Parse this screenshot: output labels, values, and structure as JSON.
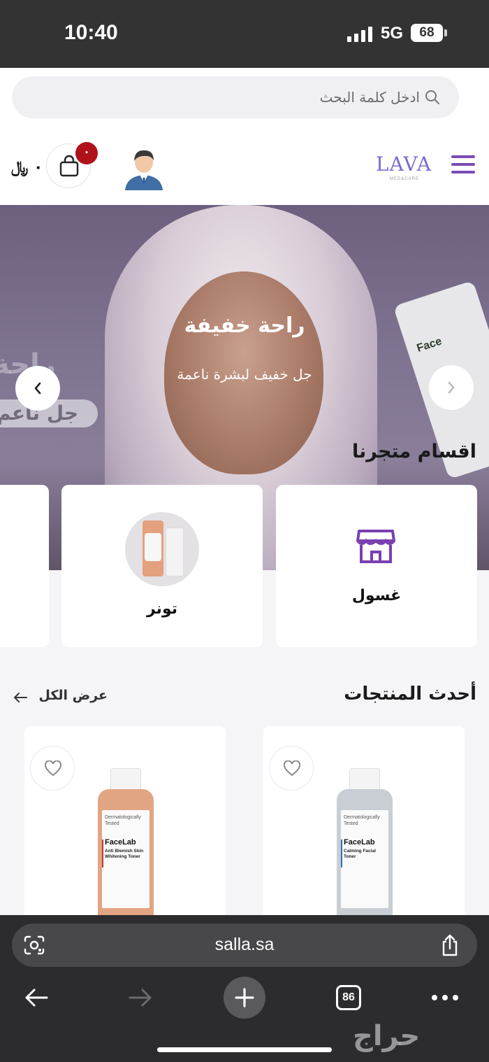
{
  "status_bar": {
    "time": "10:40",
    "network": "5G",
    "battery": "68"
  },
  "search": {
    "placeholder": "ادخل كلمة البحث"
  },
  "header": {
    "currency": "٠ ﷼",
    "cart_count": "٠",
    "logo_text": "LAVA",
    "logo_subtext": "MED&CARE"
  },
  "hero": {
    "title": "راحة خفيفة",
    "subtitle": "جل خفيف لبشرة ناعمة",
    "side_text": "راحة",
    "side_pill": "جل ناعم",
    "bottle_label": "Face"
  },
  "categories": {
    "title": "اقسام متجرنا",
    "items": [
      {
        "label": "غسول",
        "icon": "store-icon"
      },
      {
        "label": "تونر",
        "icon": "toner-image"
      }
    ]
  },
  "latest": {
    "title": "أحدث المنتجات",
    "view_all": "عرض الكل",
    "products": [
      {
        "brand": "FaceLab",
        "tested": "Dermatologically Tested",
        "name": "Calming Facial Toner",
        "body_color": "#c9ced4",
        "stripe_color": "#2f6fbf"
      },
      {
        "brand": "FaceLab",
        "tested": "Dermatologically Tested",
        "name": "Anti Blemish Skin Whitening Toner",
        "body_color": "#e2a583",
        "stripe_color": "#c0392b"
      }
    ]
  },
  "browser": {
    "url": "salla.sa",
    "tab_count": "86",
    "watermark": "حراج"
  }
}
